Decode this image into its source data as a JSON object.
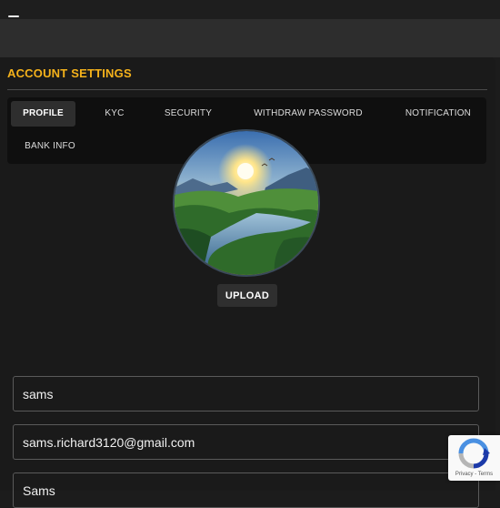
{
  "header": {
    "menu_icon": "hamburger-menu-icon"
  },
  "account": {
    "title": "ACCOUNT SETTINGS",
    "tabs": [
      {
        "label": "PROFILE",
        "active": true
      },
      {
        "label": "KYC",
        "active": false
      },
      {
        "label": "SECURITY",
        "active": false
      },
      {
        "label": "WITHDRAW PASSWORD",
        "active": false
      },
      {
        "label": "NOTIFICATION",
        "active": false
      },
      {
        "label": "BANK INFO",
        "active": false
      }
    ]
  },
  "profile": {
    "avatar_icon": "landscape-avatar-image",
    "upload_label": "UPLOAD",
    "name_value": "sams",
    "email_value": "sams.richard3120@gmail.com",
    "third_value": "Sams"
  },
  "recaptcha": {
    "icon": "recaptcha-icon",
    "privacy": "Privacy",
    "separator": " - ",
    "terms": "Terms"
  },
  "colors": {
    "accent": "#f5b21b",
    "background": "#1a1a1a",
    "tab_bar": "#0f0f0f",
    "active_tab": "#2e2e2e"
  }
}
